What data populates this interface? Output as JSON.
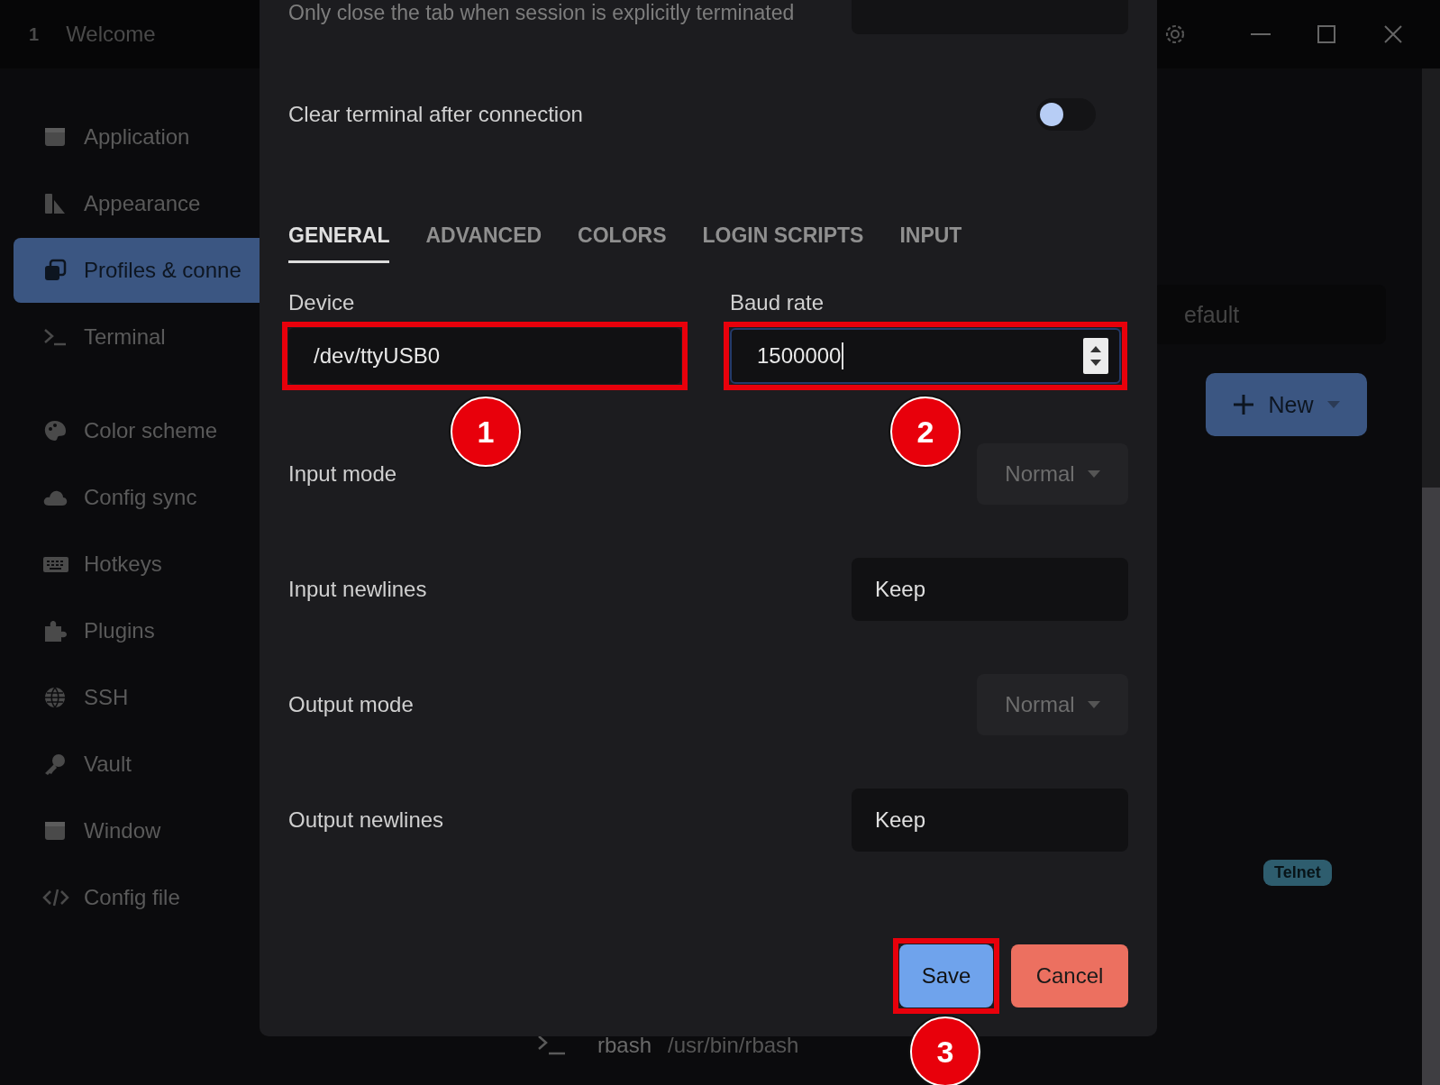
{
  "titlebar": {
    "tab": {
      "number": "1",
      "title": "Welcome",
      "selected": false
    }
  },
  "sidebar": {
    "groups": [
      [
        {
          "label": "Application",
          "selected": false
        },
        {
          "label": "Appearance",
          "selected": false
        },
        {
          "label": "Profiles & conne",
          "selected": true
        },
        {
          "label": "Terminal",
          "selected": false
        }
      ],
      [
        {
          "label": "Color scheme",
          "selected": false
        },
        {
          "label": "Config sync",
          "selected": false
        },
        {
          "label": "Hotkeys",
          "selected": false
        },
        {
          "label": "Plugins",
          "selected": false
        },
        {
          "label": "SSH",
          "selected": false
        },
        {
          "label": "Vault",
          "selected": false
        },
        {
          "label": "Window",
          "selected": false
        },
        {
          "label": "Config file",
          "selected": false
        }
      ]
    ]
  },
  "background": {
    "default_field": "efault",
    "new_button": "New",
    "badge": "Telnet",
    "profile_row": {
      "name": "rbash",
      "path": "/usr/bin/rbash"
    }
  },
  "dialog": {
    "top_note": "Only close the tab when session is explicitly terminated",
    "clear_terminal": {
      "label": "Clear terminal after connection",
      "on": false
    },
    "tabs": [
      {
        "label": "GENERAL",
        "selected": true
      },
      {
        "label": "ADVANCED",
        "selected": false
      },
      {
        "label": "COLORS",
        "selected": false
      },
      {
        "label": "LOGIN SCRIPTS",
        "selected": false
      },
      {
        "label": "INPUT",
        "selected": false
      }
    ],
    "device": {
      "label": "Device",
      "value": "/dev/ttyUSB0",
      "annotation": "1"
    },
    "baud_rate": {
      "label": "Baud rate",
      "value": "1500000",
      "annotation": "2"
    },
    "rows": [
      {
        "kind": "dropdown",
        "label": "Input mode",
        "value": "Normal"
      },
      {
        "kind": "text",
        "label": "Input newlines",
        "value": "Keep"
      },
      {
        "kind": "dropdown",
        "label": "Output mode",
        "value": "Normal"
      },
      {
        "kind": "text",
        "label": "Output newlines",
        "value": "Keep"
      }
    ],
    "save": {
      "label": "Save",
      "annotation": "3"
    },
    "cancel": {
      "label": "Cancel"
    }
  }
}
